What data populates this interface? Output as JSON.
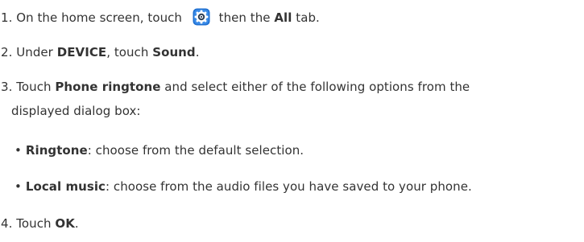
{
  "steps": [
    {
      "number": "1.",
      "text_a": "On the home screen, touch",
      "icon": "settings-gear-icon",
      "text_b": "then the",
      "bold_a": "All",
      "text_c": "tab."
    },
    {
      "number": "2.",
      "text_a": "Under",
      "bold_a": "DEVICE",
      "text_b": ", touch",
      "bold_b": "Sound",
      "text_c": "."
    },
    {
      "number": "3.",
      "text_a": "Touch",
      "bold_a": "Phone ringtone",
      "text_b": "and select either of the following options from the",
      "continuation": "displayed dialog box:"
    },
    {
      "number": "4.",
      "text_a": "Touch",
      "bold_a": "OK",
      "text_b": "."
    }
  ],
  "options": [
    {
      "bullet": "•",
      "bold": "Ringtone",
      "text": ": choose from the default selection."
    },
    {
      "bullet": "•",
      "bold": "Local music",
      "text": ": choose from the audio files you have saved to your phone."
    }
  ],
  "colors": {
    "text": "#333333",
    "icon_blue": "#1e6fd0",
    "icon_dark": "#2f3e52"
  }
}
